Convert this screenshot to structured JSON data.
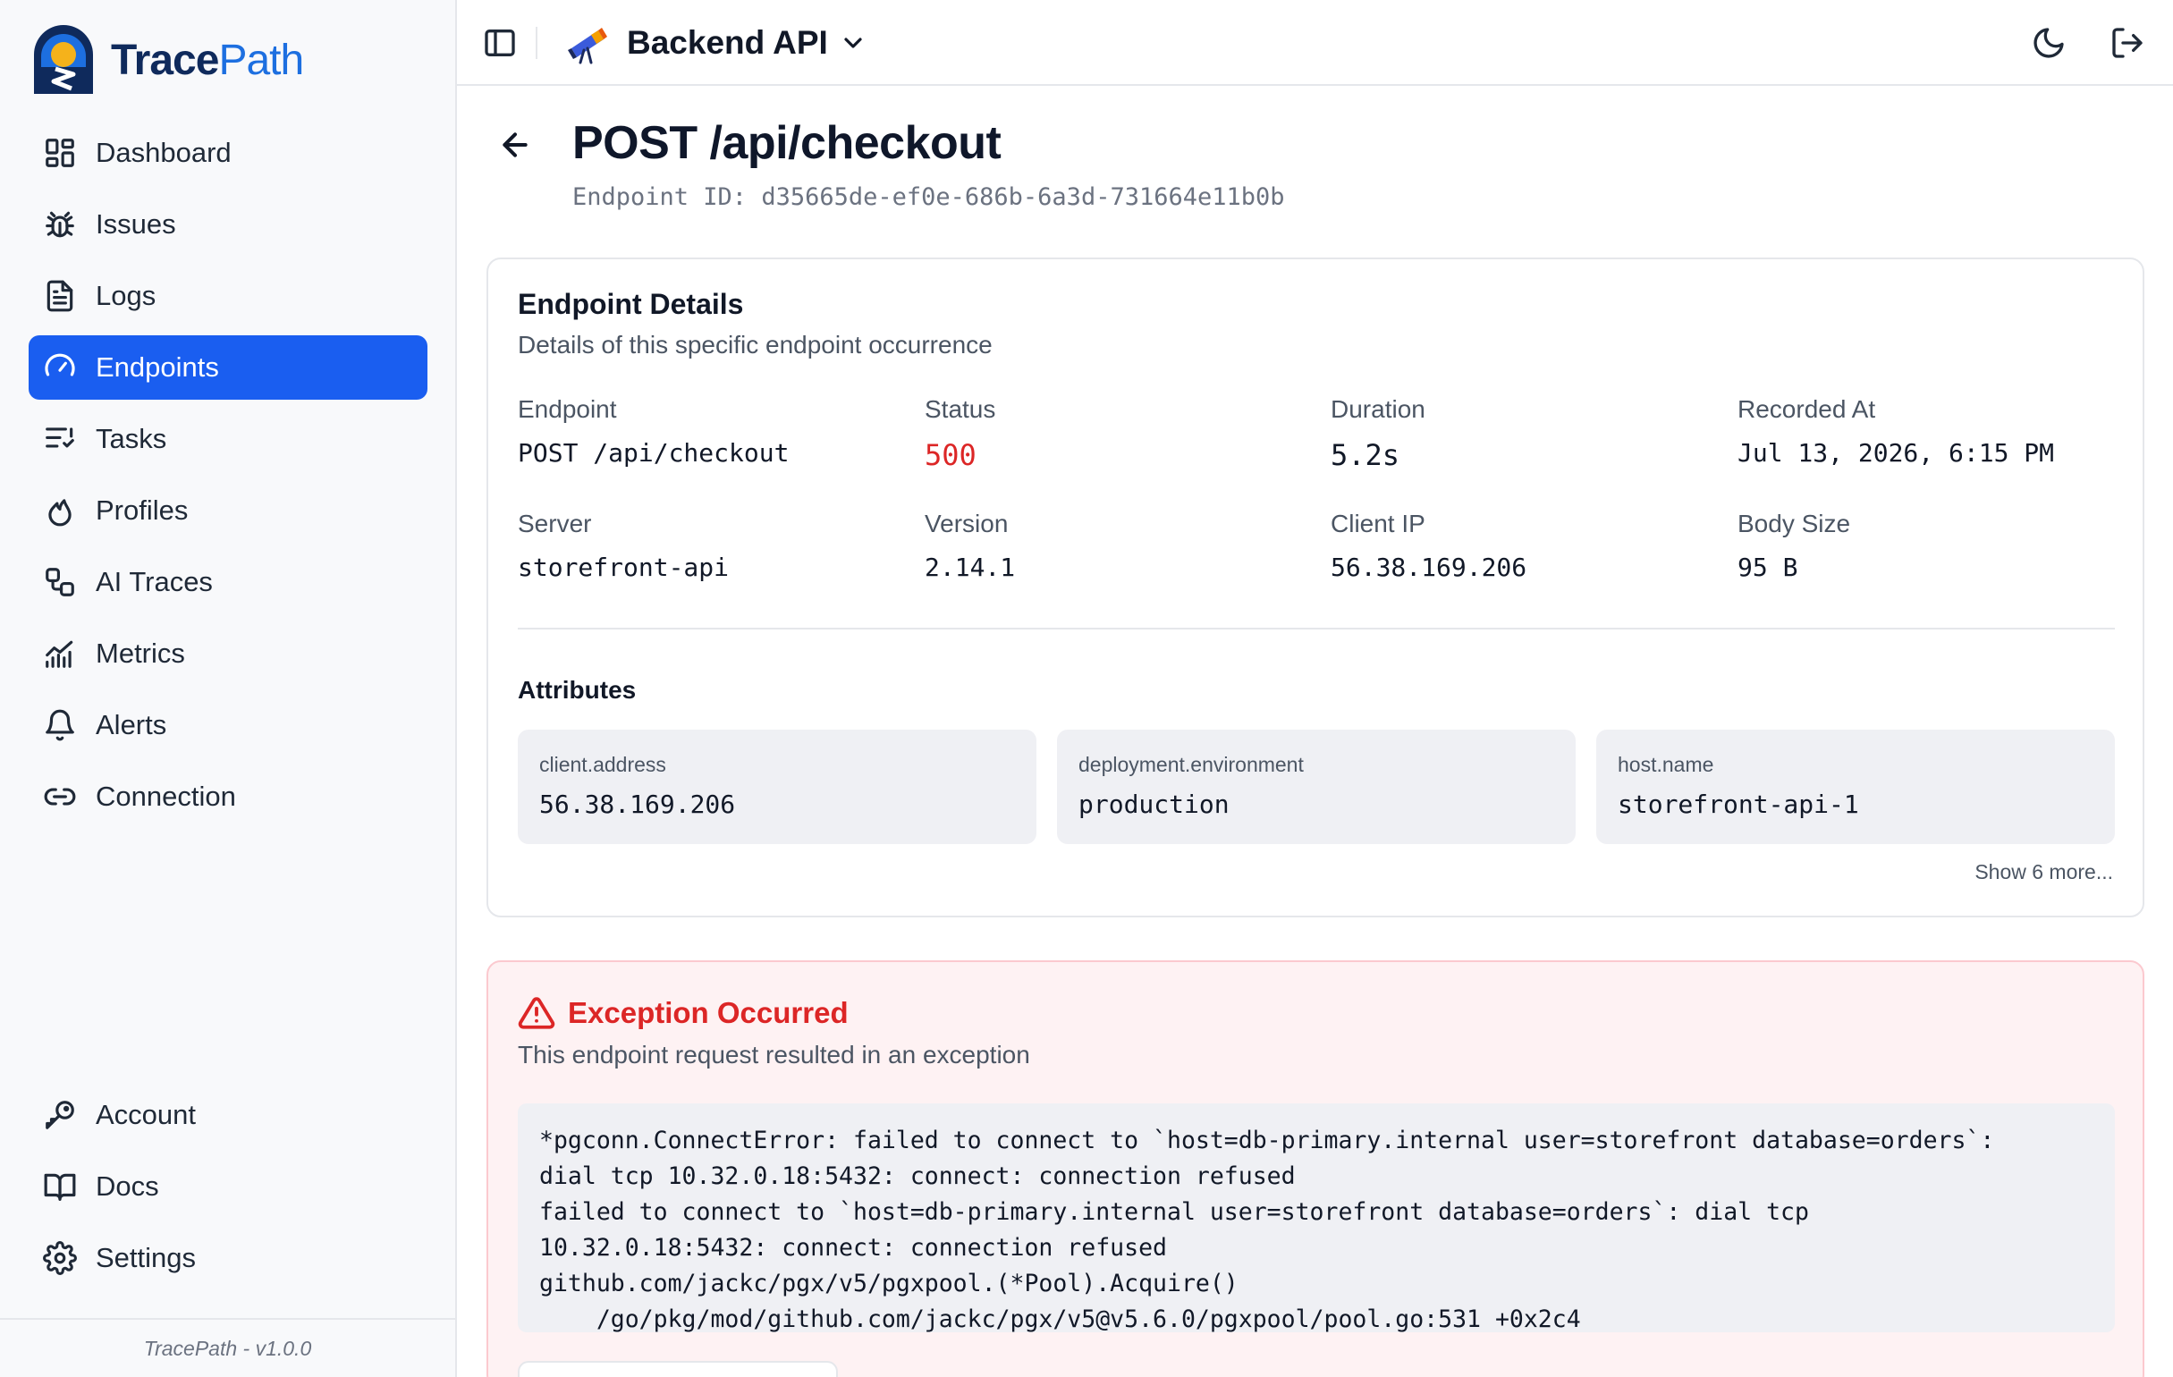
{
  "brand": {
    "part1": "Trace",
    "part2": "Path"
  },
  "sidebar": {
    "items": [
      {
        "label": "Dashboard",
        "icon": "dashboard-icon"
      },
      {
        "label": "Issues",
        "icon": "bug-icon"
      },
      {
        "label": "Logs",
        "icon": "file-text-icon"
      },
      {
        "label": "Endpoints",
        "icon": "gauge-icon",
        "active": true
      },
      {
        "label": "Tasks",
        "icon": "list-tasks-icon"
      },
      {
        "label": "Profiles",
        "icon": "flame-icon"
      },
      {
        "label": "AI Traces",
        "icon": "workflow-icon"
      },
      {
        "label": "Metrics",
        "icon": "chart-icon"
      },
      {
        "label": "Alerts",
        "icon": "bell-icon"
      },
      {
        "label": "Connection",
        "icon": "link-icon"
      }
    ],
    "bottom_items": [
      {
        "label": "Account",
        "icon": "key-icon"
      },
      {
        "label": "Docs",
        "icon": "book-icon"
      },
      {
        "label": "Settings",
        "icon": "gear-icon"
      }
    ],
    "footer": "TracePath - v1.0.0"
  },
  "topbar": {
    "project_name": "Backend API",
    "icons": [
      "sidebar-toggle-icon",
      "moon-icon",
      "logout-icon"
    ]
  },
  "page": {
    "title": "POST /api/checkout",
    "endpoint_id": "Endpoint ID: d35665de-ef0e-686b-6a3d-731664e11b0b"
  },
  "details": {
    "title": "Endpoint Details",
    "subtitle": "Details of this specific endpoint occurrence",
    "fields": [
      {
        "label": "Endpoint",
        "value": "POST /api/checkout"
      },
      {
        "label": "Status",
        "value": "500"
      },
      {
        "label": "Duration",
        "value": "5.2s"
      },
      {
        "label": "Recorded At",
        "value": "Jul 13, 2026, 6:15 PM"
      },
      {
        "label": "Server",
        "value": "storefront-api"
      },
      {
        "label": "Version",
        "value": "2.14.1"
      },
      {
        "label": "Client IP",
        "value": "56.38.169.206"
      },
      {
        "label": "Body Size",
        "value": "95 B"
      }
    ],
    "attributes_title": "Attributes",
    "attributes": [
      {
        "key": "client.address",
        "value": "56.38.169.206"
      },
      {
        "key": "deployment.environment",
        "value": "production"
      },
      {
        "key": "host.name",
        "value": "storefront-api-1"
      }
    ],
    "show_more": "Show 6 more..."
  },
  "exception": {
    "title": "Exception Occurred",
    "subtitle": "This endpoint request resulted in an exception",
    "trace": "*pgconn.ConnectError: failed to connect to `host=db-primary.internal user=storefront database=orders`:\ndial tcp 10.32.0.18:5432: connect: connection refused\nfailed to connect to `host=db-primary.internal user=storefront database=orders`: dial tcp\n10.32.0.18:5432: connect: connection refused\ngithub.com/jackc/pgx/v5/pgxpool.(*Pool).Acquire()\n    /go/pkg/mod/github.com/jackc/pgx/v5@v5.6.0/pgxpool/pool.go:531 +0x2c4",
    "status_color": "#dc2626"
  },
  "colors": {
    "accent": "#1a5ef0",
    "error": "#dc2626"
  }
}
